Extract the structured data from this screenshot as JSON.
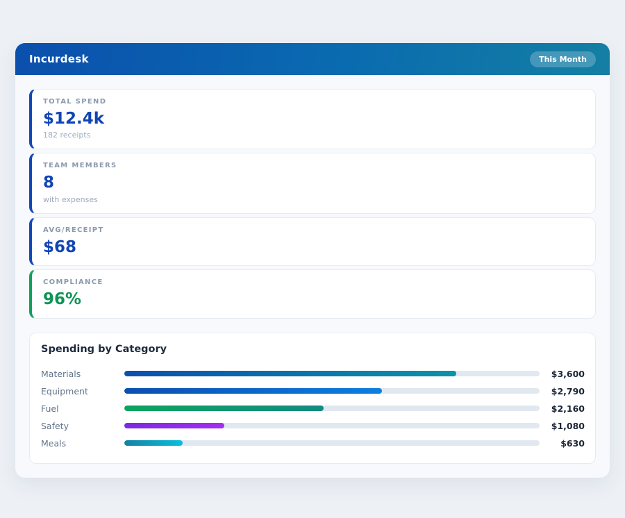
{
  "app": {
    "title": "Incurdesk",
    "period_badge": "This Month",
    "header_gradient": [
      "#0b4fad",
      "#147fa3"
    ]
  },
  "stats": [
    {
      "label": "TOTAL SPEND",
      "value": "$12.4k",
      "sub": "182 receipts",
      "accent": "#1348b8",
      "value_color": "#1144b4"
    },
    {
      "label": "TEAM MEMBERS",
      "value": "8",
      "sub": "with expenses",
      "accent": "#1348b8",
      "value_color": "#1144b4"
    },
    {
      "label": "AVG/RECEIPT",
      "value": "$68",
      "sub": "",
      "accent": "#1348b8",
      "value_color": "#1144b4"
    },
    {
      "label": "COMPLIANCE",
      "value": "96%",
      "sub": "",
      "accent": "#12a05e",
      "value_color": "#0e9355"
    }
  ],
  "chart_data": {
    "type": "bar",
    "orientation": "horizontal",
    "title": "Spending by Category",
    "categories": [
      "Materials",
      "Equipment",
      "Fuel",
      "Safety",
      "Meals"
    ],
    "values": [
      3600,
      2790,
      2160,
      1080,
      630
    ],
    "value_labels": [
      "$3,600",
      "$2,790",
      "$2,160",
      "$1,080",
      "$630"
    ],
    "scale_max": 4500,
    "track_color": "#e2e8f0",
    "bar_gradients": [
      [
        "#0b4fad",
        "#0a93a8"
      ],
      [
        "#0b4faf",
        "#0d7ee0"
      ],
      [
        "#0aa55e",
        "#148a82"
      ],
      [
        "#7c2ae0",
        "#a32df2"
      ],
      [
        "#1581a2",
        "#0abede"
      ]
    ],
    "grid": false,
    "legend": false
  }
}
